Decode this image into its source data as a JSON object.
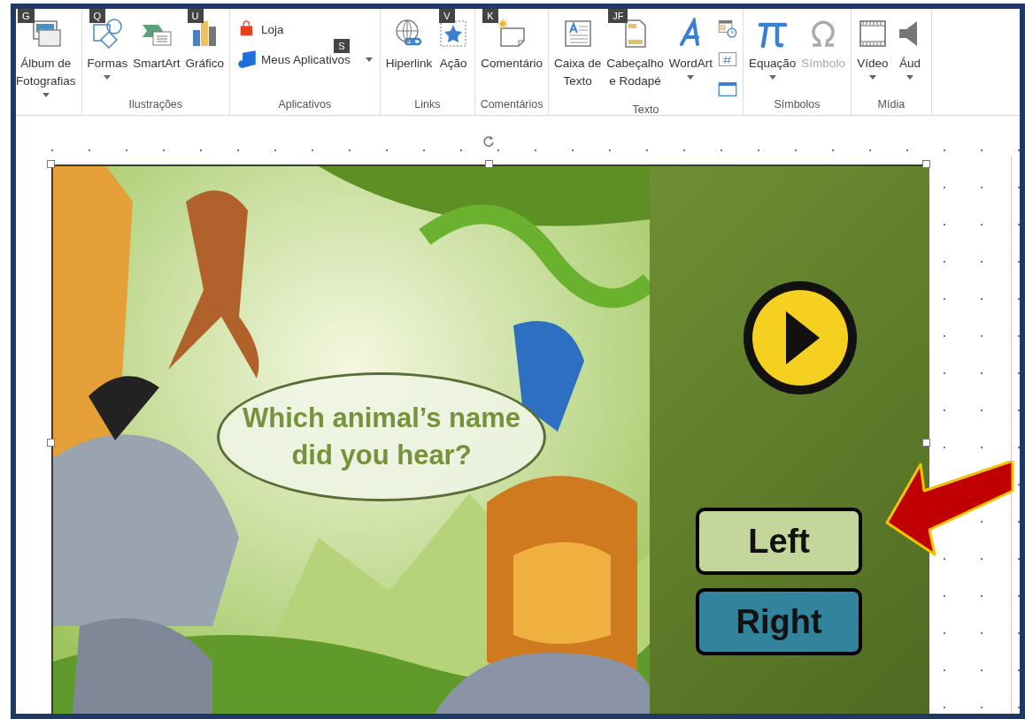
{
  "ribbon": {
    "groups": [
      {
        "buttons": [
          {
            "kind": "large",
            "label": "Álbum de\nFotografias",
            "dropdown": true,
            "keytip": "G"
          }
        ]
      },
      {
        "label": "Ilustrações",
        "buttons": [
          {
            "kind": "large",
            "label": "Formas",
            "dropdown": true,
            "keytip": "Q"
          },
          {
            "kind": "large",
            "label": "SmartArt",
            "dropdown": false
          },
          {
            "kind": "large",
            "label": "Gráfico",
            "dropdown": false,
            "keytip": "U"
          }
        ]
      },
      {
        "label": "Aplicativos",
        "buttons": [
          {
            "kind": "small",
            "label": "Loja",
            "dropdown": false
          },
          {
            "kind": "small",
            "label": "Meus Aplicativos",
            "dropdown": true,
            "keytip": "S"
          }
        ]
      },
      {
        "label": "Links",
        "buttons": [
          {
            "kind": "large",
            "label": "Hiperlink",
            "dropdown": false
          },
          {
            "kind": "large",
            "label": "Ação",
            "dropdown": false,
            "keytip": "V"
          }
        ]
      },
      {
        "label": "Comentários",
        "buttons": [
          {
            "kind": "large",
            "label": "Comentário",
            "dropdown": false,
            "keytip": "K"
          }
        ]
      },
      {
        "label": "Texto",
        "buttons": [
          {
            "kind": "large",
            "label": "Caixa de\nTexto",
            "dropdown": false
          },
          {
            "kind": "large",
            "label": "Cabeçalho\ne Rodapé",
            "dropdown": false,
            "keytip": "JF"
          },
          {
            "kind": "large",
            "label": "WordArt",
            "dropdown": true
          },
          {
            "kind": "icon"
          },
          {
            "kind": "icon"
          },
          {
            "kind": "icon"
          }
        ]
      },
      {
        "label": "Símbolos",
        "buttons": [
          {
            "kind": "large",
            "label": "Equação",
            "dropdown": true
          },
          {
            "kind": "large",
            "label": "Símbolo",
            "dropdown": false,
            "disabled": true
          }
        ]
      },
      {
        "label": "Mídia",
        "buttons": [
          {
            "kind": "large",
            "label": "Vídeo",
            "dropdown": true
          },
          {
            "kind": "large",
            "label": "Áud",
            "dropdown": true
          }
        ]
      }
    ]
  },
  "slide": {
    "selected": true,
    "question": "Which animal’s name did you hear?",
    "buttons": [
      {
        "label": "Left",
        "color": "#c4d79b"
      },
      {
        "label": "Right",
        "color": "#31849b"
      }
    ]
  }
}
